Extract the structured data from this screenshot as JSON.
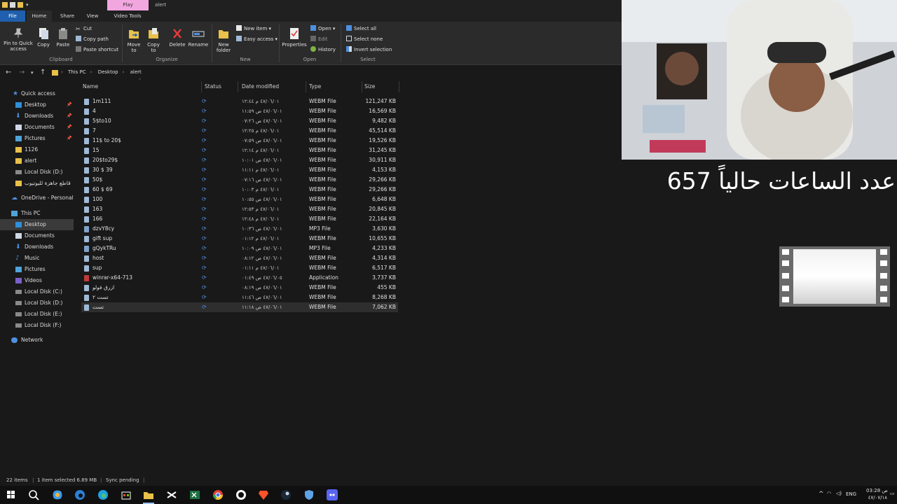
{
  "titlebar": {
    "contextual_tab": "Play",
    "title": "alert"
  },
  "ribbon_tabs": {
    "file": "File",
    "home": "Home",
    "share": "Share",
    "view": "View",
    "video_tools": "Video Tools"
  },
  "ribbon": {
    "pin": "Pin to Quick access",
    "copy": "Copy",
    "paste": "Paste",
    "cut": "Cut",
    "copy_path": "Copy path",
    "paste_shortcut": "Paste shortcut",
    "move_to": "Move to",
    "copy_to": "Copy to",
    "delete": "Delete",
    "rename": "Rename",
    "new_folder": "New folder",
    "new_item": "New item",
    "easy_access": "Easy access",
    "properties": "Properties",
    "open": "Open",
    "edit": "Edit",
    "history": "History",
    "select_all": "Select all",
    "select_none": "Select none",
    "invert_selection": "Invert selection",
    "groups": {
      "clipboard": "Clipboard",
      "organize": "Organize",
      "new": "New",
      "open": "Open",
      "select": "Select"
    }
  },
  "address": {
    "crumbs": [
      "This PC",
      "Desktop",
      "alert"
    ]
  },
  "nav": {
    "quick_access": "Quick access",
    "items": [
      "Desktop",
      "Downloads",
      "Documents",
      "Pictures",
      "1126",
      "alert",
      "Local Disk (D:)",
      "قاطع جاهزة لليوتيوب"
    ],
    "onedrive": "OneDrive - Personal",
    "this_pc": "This PC",
    "pc_items": [
      "Desktop",
      "Documents",
      "Downloads",
      "Music",
      "Pictures",
      "Videos",
      "Local Disk (C:)",
      "Local Disk (D:)",
      "Local Disk (E:)",
      "Local Disk (F:)"
    ],
    "network": "Network"
  },
  "columns": {
    "name": "Name",
    "status": "Status",
    "date": "Date modified",
    "type": "Type",
    "size": "Size"
  },
  "files": [
    {
      "name": "1m111",
      "status": "⟳",
      "date": "٤٧/٠٦/٠١ م ١٢:٤٤",
      "type": "WEBM File",
      "size": "121,247 KB"
    },
    {
      "name": "4",
      "status": "⟳",
      "date": "٤٧/٠٦/٠١ ص ١١:٥٩",
      "type": "WEBM File",
      "size": "16,569 KB"
    },
    {
      "name": "5$to10",
      "status": "⟳",
      "date": "٤٧/٠٦/٠١ ص ٠٧:٢٦",
      "type": "WEBM File",
      "size": "9,482 KB"
    },
    {
      "name": "7",
      "status": "⟳",
      "date": "٤٧/٠٦/٠١ م ١٢:٢٥",
      "type": "WEBM File",
      "size": "45,514 KB"
    },
    {
      "name": "11$ to 20$",
      "status": "⟳",
      "date": "٤٧/٠٦/٠١ ص ٠٧:٥٩",
      "type": "WEBM File",
      "size": "19,526 KB"
    },
    {
      "name": "15",
      "status": "⟳",
      "date": "٤٧/٠٦/٠١ م ١٢:١٤",
      "type": "WEBM File",
      "size": "31,245 KB"
    },
    {
      "name": "20$to29$",
      "status": "⟳",
      "date": "٤٧/٠٦/٠١ ص ١٠:٠١",
      "type": "WEBM File",
      "size": "30,911 KB"
    },
    {
      "name": "30 $ 39",
      "status": "⟳",
      "date": "٤٧/٠٦/٠١ م ١١:١١",
      "type": "WEBM File",
      "size": "4,153 KB"
    },
    {
      "name": "50$",
      "status": "⟳",
      "date": "٤٧/٠٦/٠١ ص ٠٧:١٦",
      "type": "WEBM File",
      "size": "29,266 KB"
    },
    {
      "name": "60 $ 69",
      "status": "⟳",
      "date": "٤٧/٠٦/٠١ م ١٠:٠٣",
      "type": "WEBM File",
      "size": "29,266 KB"
    },
    {
      "name": "100",
      "status": "⟳",
      "date": "٤٧/٠٦/٠١ ص ١٠:٥٥",
      "type": "WEBM File",
      "size": "6,648 KB"
    },
    {
      "name": "163",
      "status": "⟳",
      "date": "٤٧/٠٦/٠١ م ١٢:٥٣",
      "type": "WEBM File",
      "size": "20,845 KB"
    },
    {
      "name": "166",
      "status": "⟳",
      "date": "٤٧/٠٦/٠١ م ١٢:٤٨",
      "type": "WEBM File",
      "size": "22,164 KB"
    },
    {
      "name": "dzvY8cy",
      "status": "⟳",
      "date": "٤٧/٠٦/٠١ ص ١٠:٣٦",
      "type": "MP3 File",
      "size": "3,630 KB"
    },
    {
      "name": "gift sup",
      "status": "⟳",
      "date": "٤٧/٠٦/٠١ م ٠١:١٢",
      "type": "WEBM File",
      "size": "10,655 KB"
    },
    {
      "name": "gQykTRu",
      "status": "⟳",
      "date": "٤٧/٠٦/٠١ ص ١٠:٠٩",
      "type": "MP3 File",
      "size": "4,233 KB"
    },
    {
      "name": "host",
      "status": "⟳",
      "date": "٤٧/٠٦/٠١ ص ٠٨:١٢",
      "type": "WEBM File",
      "size": "4,314 KB"
    },
    {
      "name": "sup",
      "status": "⟳",
      "date": "٤٧/٠٦/٠١ م ٠١:١١",
      "type": "WEBM File",
      "size": "6,517 KB"
    },
    {
      "name": "winrar-x64-713",
      "status": "⟳",
      "date": "٤٧/٠٦/٠٥ ص ٠١:٤٩",
      "type": "Application",
      "size": "3,737 KB"
    },
    {
      "name": "ازرق فولو",
      "status": "⟳",
      "date": "٤٧/٠٦/٠١ ص ٠٨:١٩",
      "type": "WEBM File",
      "size": "455 KB"
    },
    {
      "name": "تست ٢",
      "status": "⟳",
      "date": "٤٧/٠٦/٠١ ص ١١:٤٦",
      "type": "WEBM File",
      "size": "8,268 KB"
    },
    {
      "name": "تست",
      "status": "⟳",
      "date": "٤٧/٠٦/٠١ ص ١١:١٨",
      "type": "WEBM File",
      "size": "7,062 KB"
    }
  ],
  "statusbar": {
    "items": "22 items",
    "selected": "1 item selected  6.89 MB",
    "sync": "Sync pending"
  },
  "overlay": {
    "hours_text": "عدد الساعات حالياً 657"
  },
  "tray": {
    "lang": "ENG",
    "time": "03:28 ص",
    "date": "٤٧/٠٧/١٨"
  },
  "colors": {
    "accent": "#1f5fad",
    "ctx_tab": "#f2a6df",
    "sync": "#4f8fe0"
  }
}
